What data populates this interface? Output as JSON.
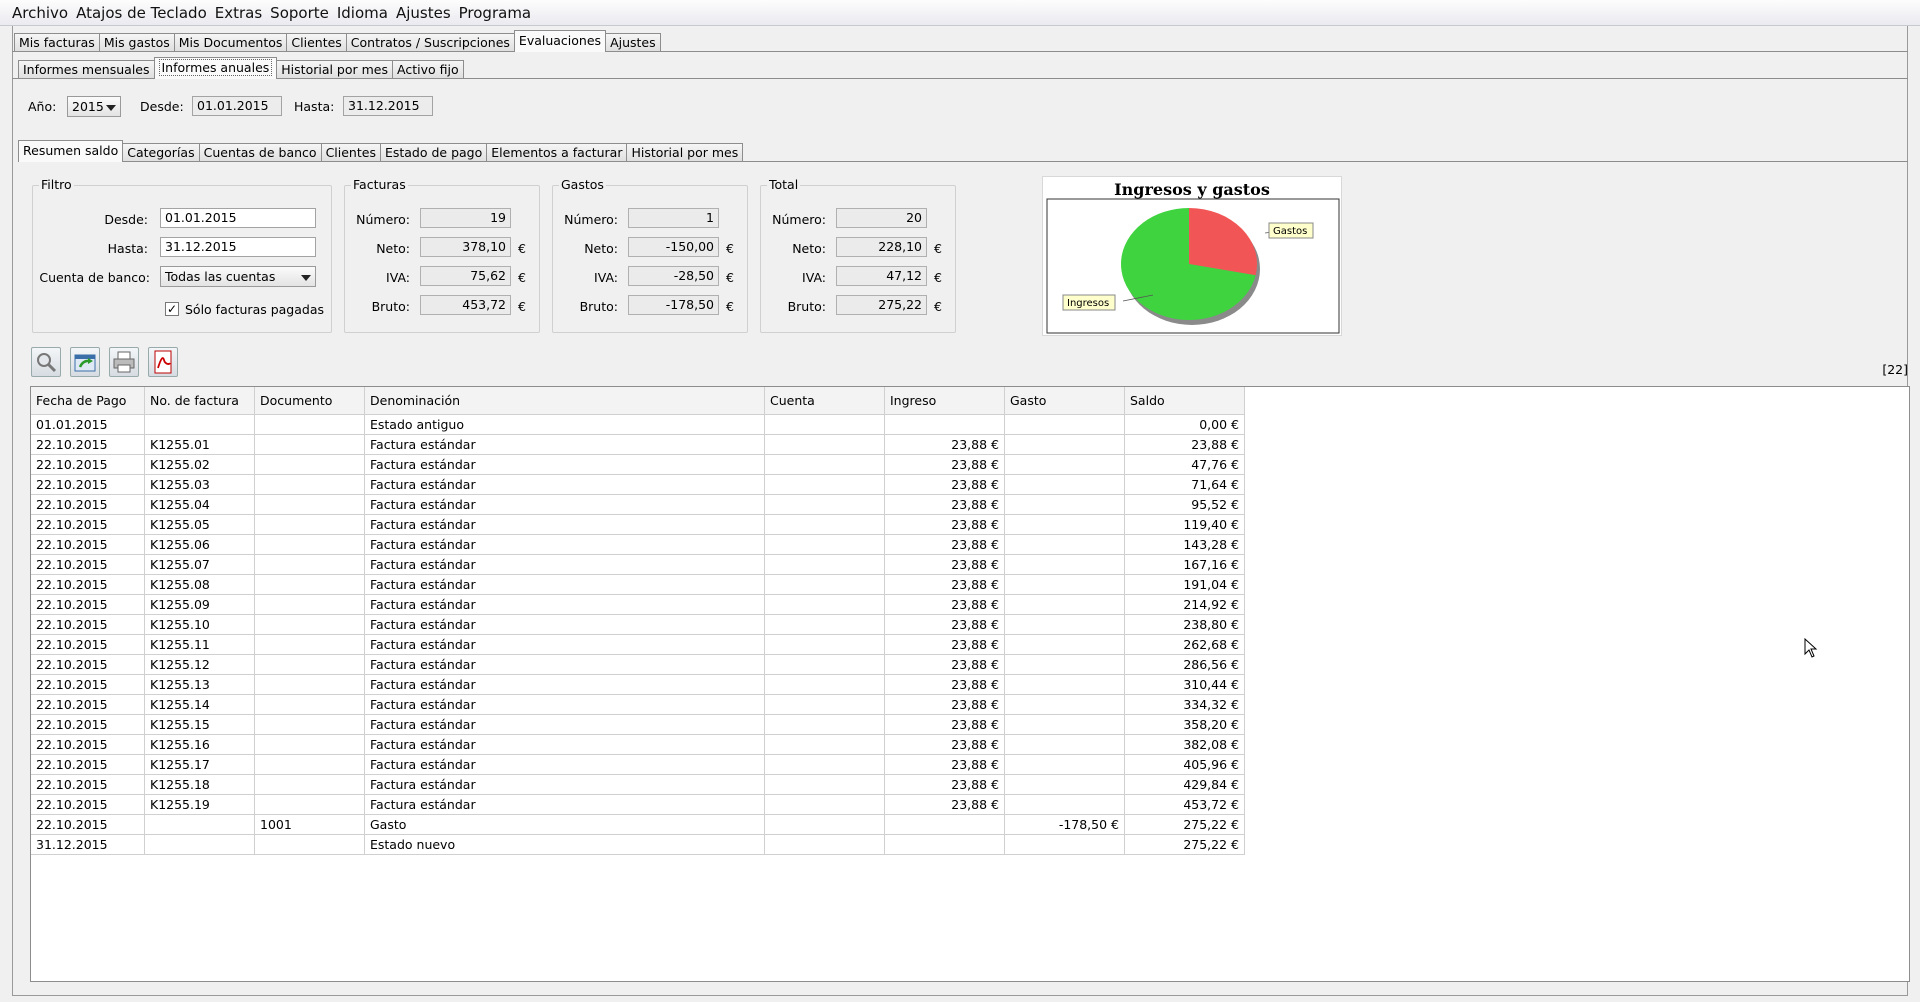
{
  "menu": [
    "Archivo",
    "Atajos de Teclado",
    "Extras",
    "Soporte",
    "Idioma",
    "Ajustes",
    "Programa"
  ],
  "main_tabs": [
    "Mis facturas",
    "Mis gastos",
    "Mis Documentos",
    "Clientes",
    "Contratos / Suscripciones",
    "Evaluaciones",
    "Ajustes"
  ],
  "main_tab_selected": "Evaluaciones",
  "sub_tabs": [
    "Informes mensuales",
    "Informes anuales",
    "Historial por mes",
    "Activo fijo"
  ],
  "sub_tab_selected": "Informes anuales",
  "period": {
    "year_label": "Año:",
    "year_value": "2015",
    "from_label": "Desde:",
    "from_value": "01.01.2015",
    "to_label": "Hasta:",
    "to_value": "31.12.2015"
  },
  "report_tabs": [
    "Resumen saldo",
    "Categorías",
    "Cuentas de banco",
    "Clientes",
    "Estado de pago",
    "Elementos a facturar",
    "Historial por mes"
  ],
  "report_tab_selected": "Resumen saldo",
  "filter": {
    "title": "Filtro",
    "from_label": "Desde:",
    "from_value": "01.01.2015",
    "to_label": "Hasta:",
    "to_value": "31.12.2015",
    "account_label": "Cuenta de banco:",
    "account_value": "Todas las cuentas",
    "paid_only_label": "Sólo facturas pagadas",
    "paid_only_checked": true
  },
  "summaries": [
    {
      "title": "Facturas",
      "numero_label": "Número:",
      "numero": "19",
      "neto_label": "Neto:",
      "neto": "378,10",
      "iva_label": "IVA:",
      "iva": "75,62",
      "bruto_label": "Bruto:",
      "bruto": "453,72",
      "currency": "€"
    },
    {
      "title": "Gastos",
      "numero_label": "Número:",
      "numero": "1",
      "neto_label": "Neto:",
      "neto": "-150,00",
      "iva_label": "IVA:",
      "iva": "-28,50",
      "bruto_label": "Bruto:",
      "bruto": "-178,50",
      "currency": "€"
    },
    {
      "title": "Total",
      "numero_label": "Número:",
      "numero": "20",
      "neto_label": "Neto:",
      "neto": "228,10",
      "iva_label": "IVA:",
      "iva": "47,12",
      "bruto_label": "Bruto:",
      "bruto": "275,22",
      "currency": "€"
    }
  ],
  "chart_data": {
    "type": "pie",
    "title": "Ingresos y gastos",
    "categories": [
      "Ingresos",
      "Gastos"
    ],
    "values": [
      453.72,
      178.5
    ],
    "colors": [
      "#3fd43f",
      "#f25555"
    ]
  },
  "toolbar_icons": [
    "magnifier-icon",
    "export-icon",
    "print-icon",
    "pdf-icon"
  ],
  "row_count": "[22]",
  "table": {
    "columns": [
      "Fecha de Pago",
      "No. de factura",
      "Documento",
      "Denominación",
      "Cuenta",
      "Ingreso",
      "Gasto",
      "Saldo"
    ],
    "rows": [
      [
        "01.01.2015",
        "",
        "",
        "Estado antiguo",
        "",
        "",
        "",
        "0,00 €"
      ],
      [
        "22.10.2015",
        "K1255.01",
        "",
        "Factura estándar",
        "",
        "23,88 €",
        "",
        "23,88 €"
      ],
      [
        "22.10.2015",
        "K1255.02",
        "",
        "Factura estándar",
        "",
        "23,88 €",
        "",
        "47,76 €"
      ],
      [
        "22.10.2015",
        "K1255.03",
        "",
        "Factura estándar",
        "",
        "23,88 €",
        "",
        "71,64 €"
      ],
      [
        "22.10.2015",
        "K1255.04",
        "",
        "Factura estándar",
        "",
        "23,88 €",
        "",
        "95,52 €"
      ],
      [
        "22.10.2015",
        "K1255.05",
        "",
        "Factura estándar",
        "",
        "23,88 €",
        "",
        "119,40 €"
      ],
      [
        "22.10.2015",
        "K1255.06",
        "",
        "Factura estándar",
        "",
        "23,88 €",
        "",
        "143,28 €"
      ],
      [
        "22.10.2015",
        "K1255.07",
        "",
        "Factura estándar",
        "",
        "23,88 €",
        "",
        "167,16 €"
      ],
      [
        "22.10.2015",
        "K1255.08",
        "",
        "Factura estándar",
        "",
        "23,88 €",
        "",
        "191,04 €"
      ],
      [
        "22.10.2015",
        "K1255.09",
        "",
        "Factura estándar",
        "",
        "23,88 €",
        "",
        "214,92 €"
      ],
      [
        "22.10.2015",
        "K1255.10",
        "",
        "Factura estándar",
        "",
        "23,88 €",
        "",
        "238,80 €"
      ],
      [
        "22.10.2015",
        "K1255.11",
        "",
        "Factura estándar",
        "",
        "23,88 €",
        "",
        "262,68 €"
      ],
      [
        "22.10.2015",
        "K1255.12",
        "",
        "Factura estándar",
        "",
        "23,88 €",
        "",
        "286,56 €"
      ],
      [
        "22.10.2015",
        "K1255.13",
        "",
        "Factura estándar",
        "",
        "23,88 €",
        "",
        "310,44 €"
      ],
      [
        "22.10.2015",
        "K1255.14",
        "",
        "Factura estándar",
        "",
        "23,88 €",
        "",
        "334,32 €"
      ],
      [
        "22.10.2015",
        "K1255.15",
        "",
        "Factura estándar",
        "",
        "23,88 €",
        "",
        "358,20 €"
      ],
      [
        "22.10.2015",
        "K1255.16",
        "",
        "Factura estándar",
        "",
        "23,88 €",
        "",
        "382,08 €"
      ],
      [
        "22.10.2015",
        "K1255.17",
        "",
        "Factura estándar",
        "",
        "23,88 €",
        "",
        "405,96 €"
      ],
      [
        "22.10.2015",
        "K1255.18",
        "",
        "Factura estándar",
        "",
        "23,88 €",
        "",
        "429,84 €"
      ],
      [
        "22.10.2015",
        "K1255.19",
        "",
        "Factura estándar",
        "",
        "23,88 €",
        "",
        "453,72 €"
      ],
      [
        "22.10.2015",
        "",
        "1001",
        "Gasto",
        "",
        "",
        "-178,50 €",
        "275,22 €"
      ],
      [
        "31.12.2015",
        "",
        "",
        "Estado nuevo",
        "",
        "",
        "",
        "275,22 €"
      ]
    ]
  }
}
